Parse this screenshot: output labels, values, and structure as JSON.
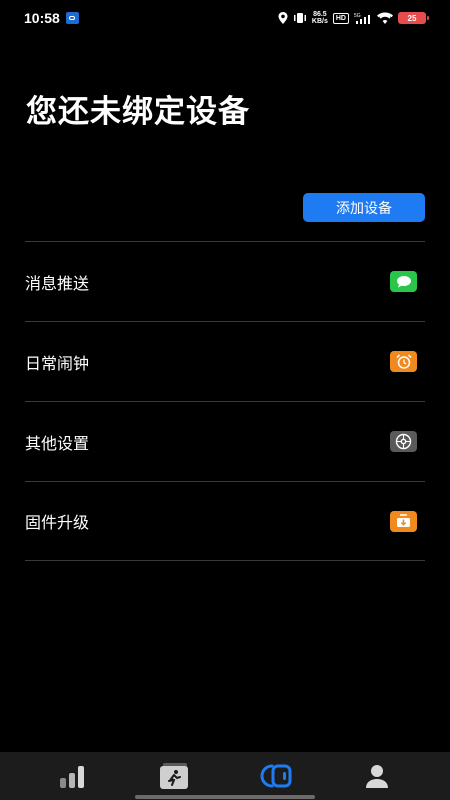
{
  "status_bar": {
    "time": "10:58",
    "net_speed_value": "86.5",
    "net_speed_unit": "KB/s",
    "hd_label": "HD",
    "signal_label": "5G",
    "battery_level": "25"
  },
  "page": {
    "title": "您还未绑定设备",
    "add_device_label": "添加设备"
  },
  "menu": {
    "items": [
      {
        "label": "消息推送",
        "icon": "message-icon",
        "color": "#29c649"
      },
      {
        "label": "日常闹钟",
        "icon": "alarm-clock-icon",
        "color": "#f08a1f"
      },
      {
        "label": "其他设置",
        "icon": "settings-icon",
        "color": "#5a5a5a"
      },
      {
        "label": "固件升级",
        "icon": "firmware-update-icon",
        "color": "#f08a1f"
      }
    ]
  },
  "bottom_nav": {
    "tabs": [
      {
        "icon": "stats-bars-icon",
        "active": false
      },
      {
        "icon": "sport-run-icon",
        "active": false
      },
      {
        "icon": "device-watch-icon",
        "active": true
      },
      {
        "icon": "profile-icon",
        "active": false
      }
    ]
  },
  "colors": {
    "accent": "#1f7bf2",
    "background": "#000000",
    "divider": "#3a3a3a",
    "nav_background": "#1c1c1c"
  }
}
